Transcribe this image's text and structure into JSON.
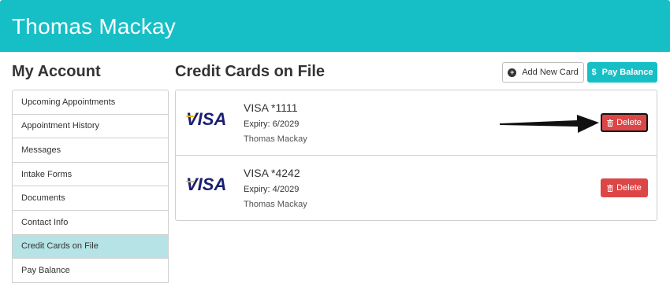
{
  "header": {
    "title": "Thomas Mackay"
  },
  "sidebar": {
    "title": "My Account",
    "items": [
      {
        "label": "Upcoming Appointments",
        "active": false
      },
      {
        "label": "Appointment History",
        "active": false
      },
      {
        "label": "Messages",
        "active": false
      },
      {
        "label": "Intake Forms",
        "active": false
      },
      {
        "label": "Documents",
        "active": false
      },
      {
        "label": "Contact Info",
        "active": false
      },
      {
        "label": "Credit Cards on File",
        "active": true
      },
      {
        "label": "Pay Balance",
        "active": false
      }
    ]
  },
  "main": {
    "title": "Credit Cards on File",
    "add_card_label": "Add New Card",
    "pay_balance_label": "Pay Balance",
    "cards": [
      {
        "brand_logo": "VISA",
        "name": "VISA *1111",
        "expiry": "Expiry: 6/2029",
        "holder": "Thomas Mackay",
        "delete_label": "Delete"
      },
      {
        "brand_logo": "VISA",
        "name": "VISA *4242",
        "expiry": "Expiry: 4/2029",
        "holder": "Thomas Mackay",
        "delete_label": "Delete"
      }
    ]
  },
  "colors": {
    "accent": "#16bfc6",
    "danger": "#dc4646",
    "active_item": "#b6e3e5",
    "visa_blue": "#1a1f71",
    "visa_gold": "#f7b600"
  },
  "icons": {
    "add": "plus-circle-icon",
    "pay": "dollar-icon",
    "delete": "trash-icon",
    "annotation": "arrow-icon"
  }
}
